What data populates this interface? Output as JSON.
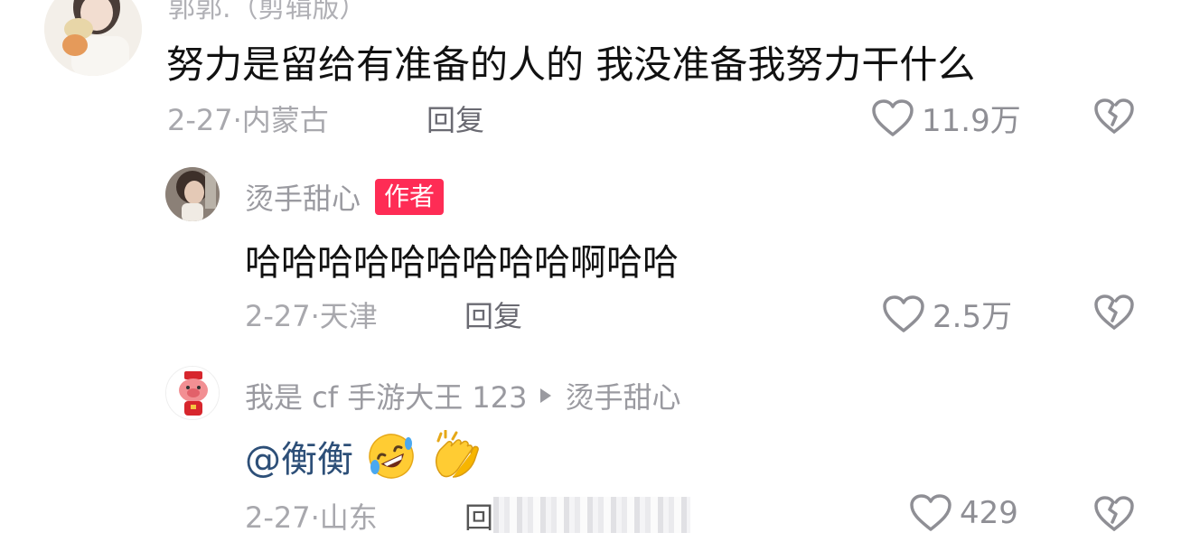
{
  "comments": [
    {
      "username": "郭郭.（剪辑版）",
      "text": "努力是留给有准备的人的 我没准备我努力干什么",
      "date": "2-27·",
      "location": "内蒙古",
      "reply_label": "回复",
      "likes": "11.9万"
    },
    {
      "username": "烫手甜心",
      "badge": "作者",
      "text": "哈哈哈哈哈哈哈哈哈啊哈哈",
      "date": "2-27·",
      "location": "天津",
      "reply_label": "回复",
      "likes": "2.5万"
    },
    {
      "username": "我是 cf 手游大王 123",
      "reply_to": "烫手甜心",
      "text": "@衡衡",
      "date": "2-27·",
      "location": "山东",
      "reply_label": "回",
      "likes": "429"
    }
  ],
  "icons": {
    "like": "heart-outline-icon",
    "dislike": "broken-heart-icon",
    "reply_arrow": "triangle-right-icon",
    "emoji_1": "rofl-emoji-icon",
    "emoji_2": "clapping-hands-emoji-icon"
  }
}
